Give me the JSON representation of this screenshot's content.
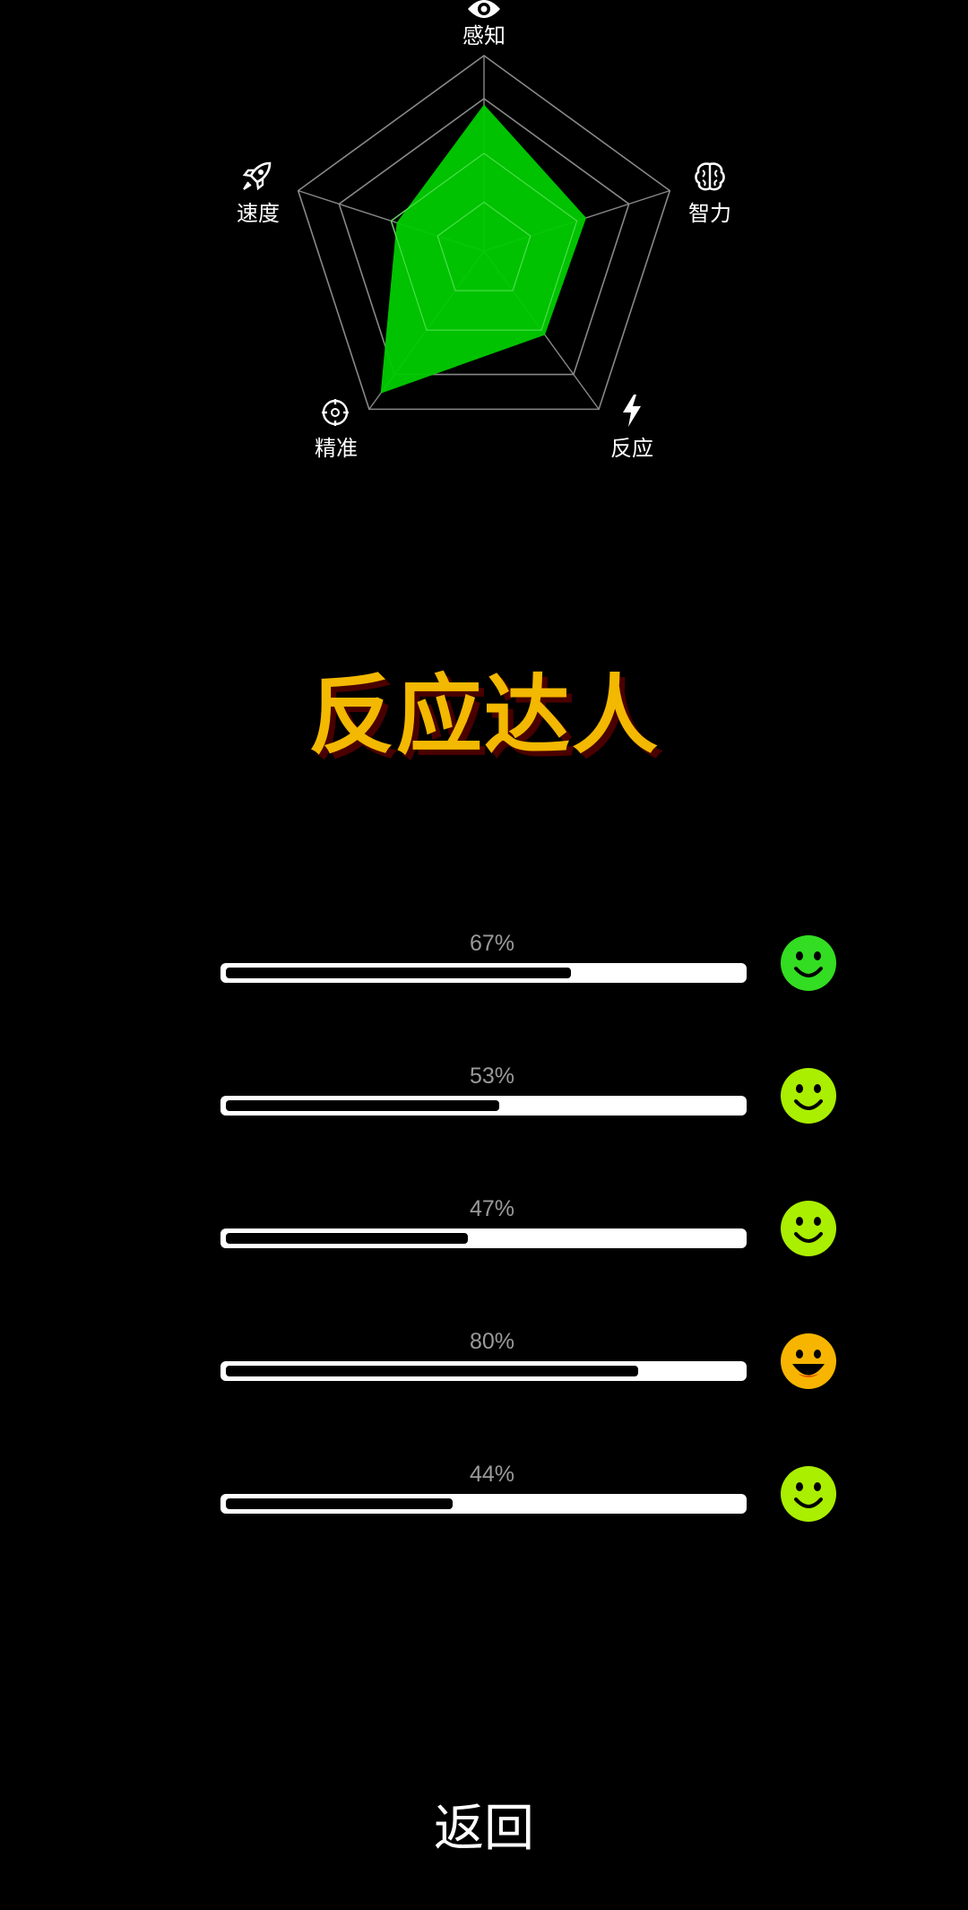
{
  "radar": {
    "axes": [
      {
        "label": "感知",
        "icon": "eye-icon",
        "value": 0.75
      },
      {
        "label": "智力",
        "icon": "brain-icon",
        "value": 0.55
      },
      {
        "label": "反应",
        "icon": "lightning-icon",
        "value": 0.53
      },
      {
        "label": "精准",
        "icon": "crosshair-icon",
        "value": 0.9
      },
      {
        "label": "速度",
        "icon": "rocket-icon",
        "value": 0.47
      }
    ],
    "fill_color": "#00cc00",
    "grid_color": "#888888"
  },
  "title": "反应达人",
  "title_color": "#f3b800",
  "bars": [
    {
      "percent_text": "67%",
      "value": 0.67,
      "face": "smile",
      "face_color": "#33dd22"
    },
    {
      "percent_text": "53%",
      "value": 0.53,
      "face": "smile",
      "face_color": "#aaee00"
    },
    {
      "percent_text": "47%",
      "value": 0.47,
      "face": "smile",
      "face_color": "#aaee00"
    },
    {
      "percent_text": "80%",
      "value": 0.8,
      "face": "grin",
      "face_color": "#f7b500"
    },
    {
      "percent_text": "44%",
      "value": 0.44,
      "face": "smile",
      "face_color": "#aaee00"
    }
  ],
  "back_label": "返回"
}
